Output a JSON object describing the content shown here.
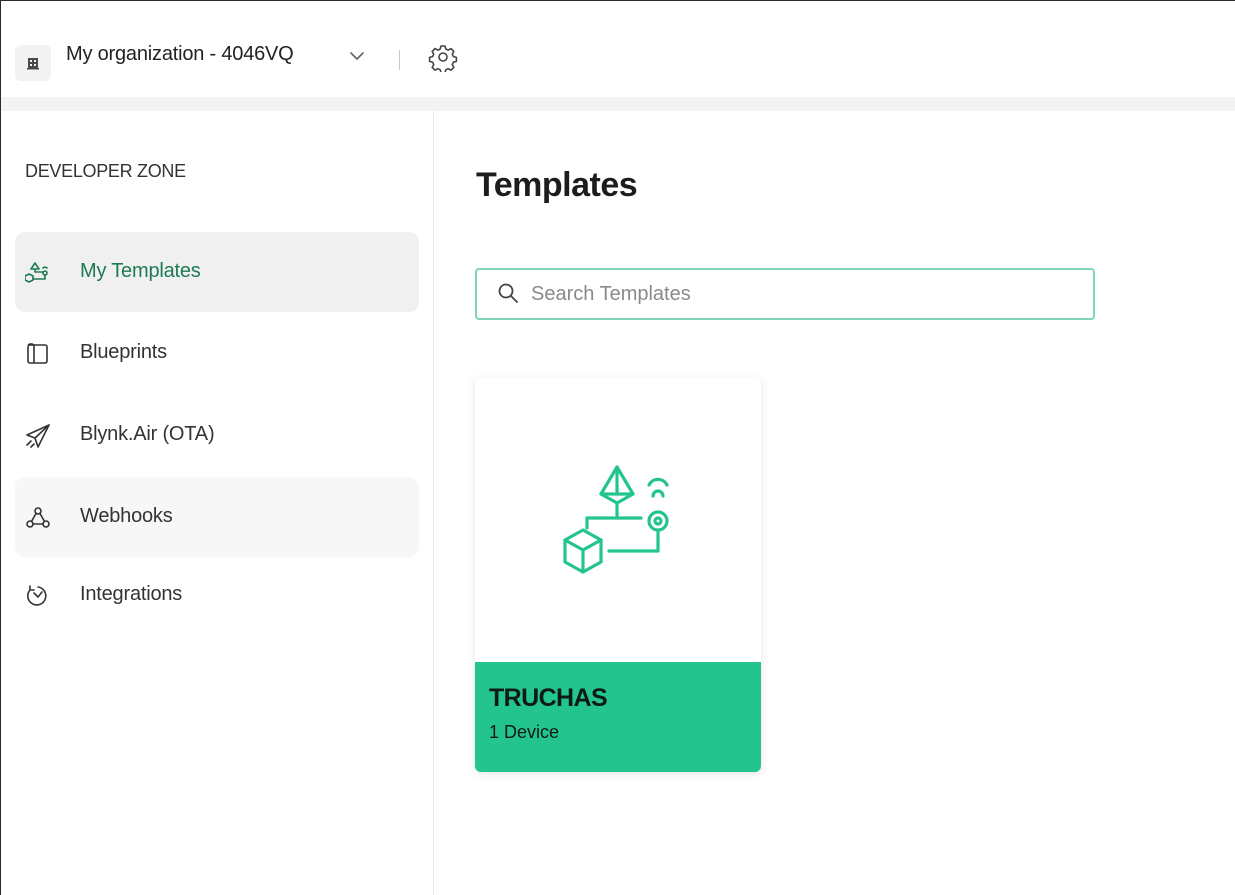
{
  "header": {
    "org_name": "My organization - 4046VQ"
  },
  "sidebar": {
    "section_title": "DEVELOPER ZONE",
    "items": [
      {
        "label": "My Templates",
        "icon": "templates-icon",
        "state": "active"
      },
      {
        "label": "Blueprints",
        "icon": "blueprints-icon",
        "state": "normal"
      },
      {
        "label": "Blynk.Air (OTA)",
        "icon": "paper-plane-icon",
        "state": "normal"
      },
      {
        "label": "Webhooks",
        "icon": "webhooks-icon",
        "state": "hover"
      },
      {
        "label": "Integrations",
        "icon": "integrations-icon",
        "state": "normal"
      }
    ]
  },
  "main": {
    "title": "Templates",
    "search": {
      "placeholder": "Search Templates",
      "value": ""
    },
    "templates": [
      {
        "name": "TRUCHAS",
        "devices": "1 Device"
      }
    ]
  },
  "colors": {
    "accent": "#23c48e",
    "active_text": "#1e7a54",
    "search_border": "#7fd6b4"
  }
}
